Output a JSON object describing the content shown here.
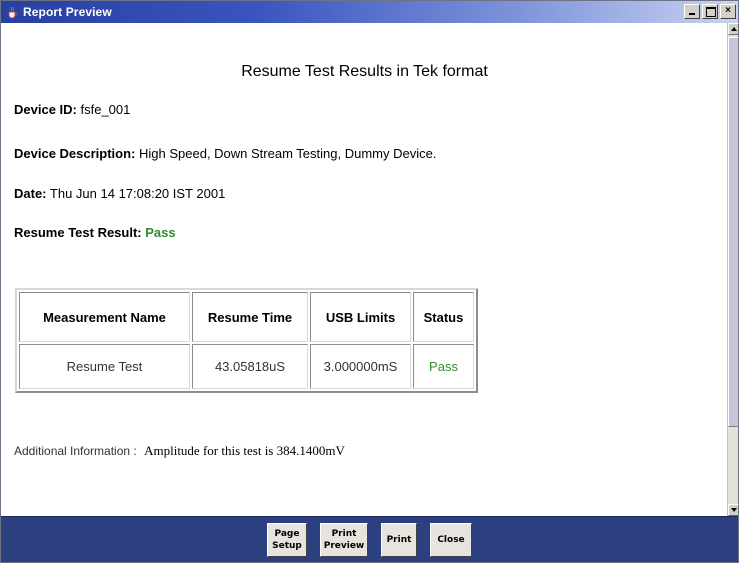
{
  "window": {
    "title": "Report Preview",
    "icon": "java-coffee-icon",
    "controls": {
      "minimize": "_",
      "maximize": "□",
      "close": "×"
    }
  },
  "report": {
    "title": "Resume Test Results in Tek format",
    "device_id": {
      "label": "Device ID:",
      "value": "fsfe_001"
    },
    "device_description": {
      "label": "Device Description:",
      "value": "High Speed, Down Stream Testing, Dummy Device."
    },
    "date": {
      "label": "Date:",
      "value": "Thu Jun 14 17:08:20 IST 2001"
    },
    "result": {
      "label": "Resume Test Result:",
      "value": "Pass"
    }
  },
  "table": {
    "headers": [
      "Measurement Name",
      "Resume Time",
      "USB Limits",
      "Status"
    ],
    "rows": [
      [
        "Resume Test",
        "43.05818uS",
        "3.000000mS",
        "Pass"
      ]
    ]
  },
  "additional_info": {
    "label": "Additional Information :",
    "value": "Amplitude for this test is 384.1400mV"
  },
  "buttons": {
    "page_setup": [
      "Page",
      "Setup"
    ],
    "print_preview": [
      "Print",
      "Preview"
    ],
    "print": "Print",
    "close": "Close"
  },
  "colors": {
    "titlebar": "#273fa0",
    "footer": "#2c3f7e",
    "pass": "#2e8b2e"
  }
}
